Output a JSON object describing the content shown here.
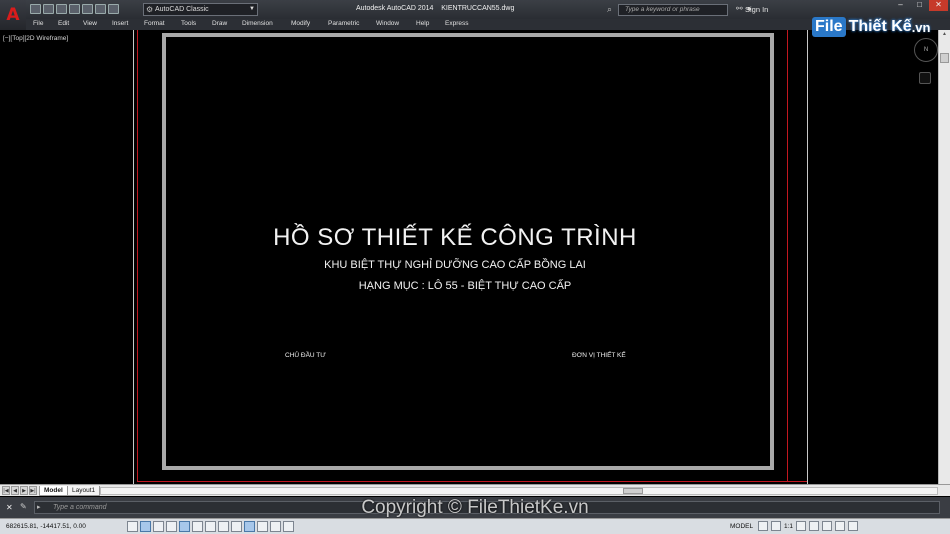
{
  "titlebar": {
    "app_icon": "A",
    "workspace": "AutoCAD Classic",
    "app_title": "Autodesk AutoCAD 2014",
    "file_name": "KIENTRUCCAN55.dwg",
    "search_placeholder": "Type a keyword or phrase",
    "sign_in": "Sign In"
  },
  "menu": [
    "File",
    "Edit",
    "View",
    "Insert",
    "Format",
    "Tools",
    "Draw",
    "Dimension",
    "Modify",
    "Parametric",
    "Window",
    "Help",
    "Express"
  ],
  "watermark_logo": {
    "part1": "File",
    "part2": "Thiết Kế",
    "part3": ".vn"
  },
  "viewport": {
    "label": "[−][Top][2D Wireframe]",
    "title_main": "HỒ SƠ THIẾT KẾ CÔNG TRÌNH",
    "title_sub1": "KHU BIỆT THỰ NGHỈ DƯỠNG CAO CẤP BỒNG LAI",
    "title_sub2": "HẠNG MỤC : LÔ 55 - BIỆT THỰ CAO CẤP",
    "sig_left": "CHỦ ĐẦU TƯ",
    "sig_right": "ĐƠN VỊ THIẾT KẾ"
  },
  "tabs": {
    "model": "Model",
    "layout1": "Layout1"
  },
  "command": {
    "placeholder": "Type a command"
  },
  "copyright": "Copyright © FileThietKe.vn",
  "status": {
    "coords": "682615.81, -14417.51, 0.00",
    "model": "MODEL",
    "scale": "1:1"
  },
  "colors": {
    "frame": "#a9a9a9",
    "boundary": "#c2171f",
    "close": "#c63a2a"
  }
}
